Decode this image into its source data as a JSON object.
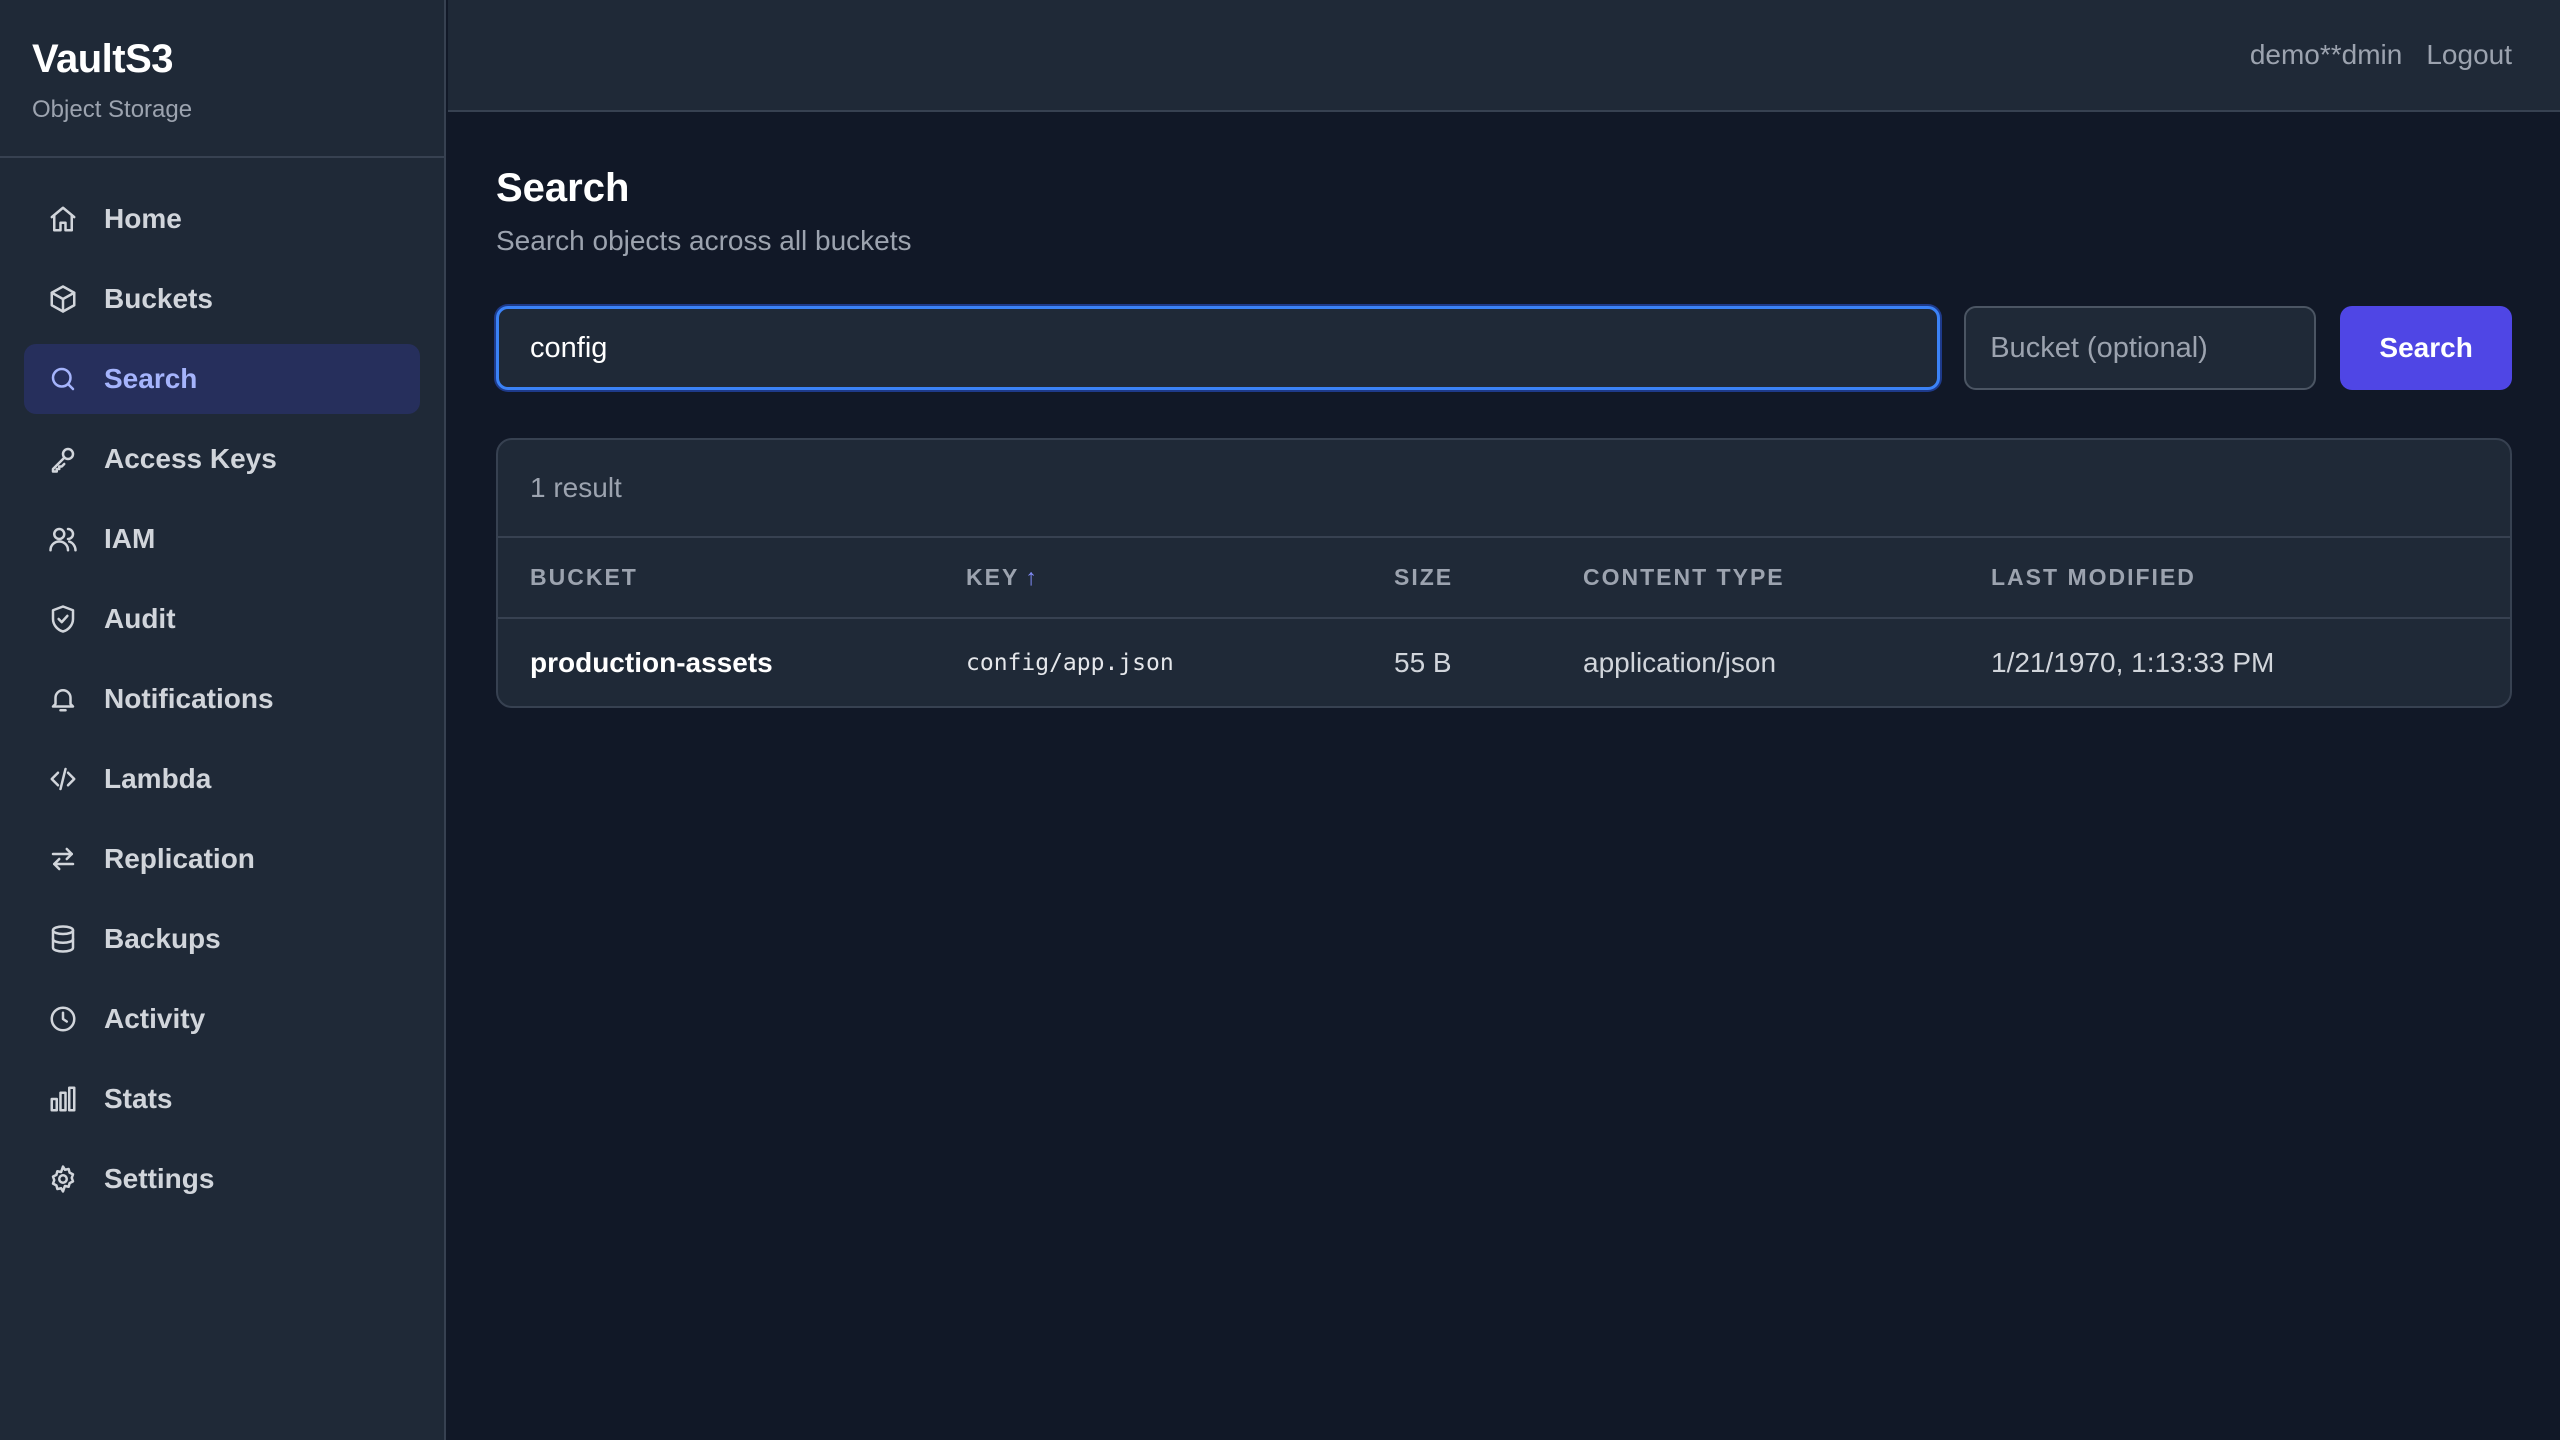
{
  "brand": {
    "title": "VaultS3",
    "subtitle": "Object Storage"
  },
  "sidebar": {
    "items": [
      {
        "label": "Home",
        "icon": "home-icon",
        "active": false
      },
      {
        "label": "Buckets",
        "icon": "box-icon",
        "active": false
      },
      {
        "label": "Search",
        "icon": "search-icon",
        "active": true
      },
      {
        "label": "Access Keys",
        "icon": "key-icon",
        "active": false
      },
      {
        "label": "IAM",
        "icon": "users-icon",
        "active": false
      },
      {
        "label": "Audit",
        "icon": "shield-check-icon",
        "active": false
      },
      {
        "label": "Notifications",
        "icon": "bell-icon",
        "active": false
      },
      {
        "label": "Lambda",
        "icon": "code-icon",
        "active": false
      },
      {
        "label": "Replication",
        "icon": "arrows-swap-icon",
        "active": false
      },
      {
        "label": "Backups",
        "icon": "database-icon",
        "active": false
      },
      {
        "label": "Activity",
        "icon": "clock-icon",
        "active": false
      },
      {
        "label": "Stats",
        "icon": "bar-chart-icon",
        "active": false
      },
      {
        "label": "Settings",
        "icon": "gear-icon",
        "active": false
      }
    ]
  },
  "header": {
    "user": "demo**dmin",
    "logout": "Logout"
  },
  "page": {
    "title": "Search",
    "subtitle": "Search objects across all buckets"
  },
  "search": {
    "query": "config",
    "bucket_placeholder": "Bucket (optional)",
    "button_label": "Search"
  },
  "results": {
    "count_text": "1 result",
    "columns": {
      "bucket": "BUCKET",
      "key": "KEY",
      "key_sort": "↑",
      "size": "SIZE",
      "content_type": "CONTENT TYPE",
      "last_modified": "LAST MODIFIED"
    },
    "rows": [
      {
        "bucket": "production-assets",
        "key": "config/app.json",
        "size": "55 B",
        "content_type": "application/json",
        "last_modified": "1/21/1970, 1:13:33 PM"
      }
    ]
  },
  "colors": {
    "background": "#111827",
    "panel": "#1f2937",
    "accent": "#4f46e5",
    "active_nav_bg": "#262f5c",
    "active_nav_text": "#a5b4fc",
    "focus_ring": "#3b82f6"
  }
}
